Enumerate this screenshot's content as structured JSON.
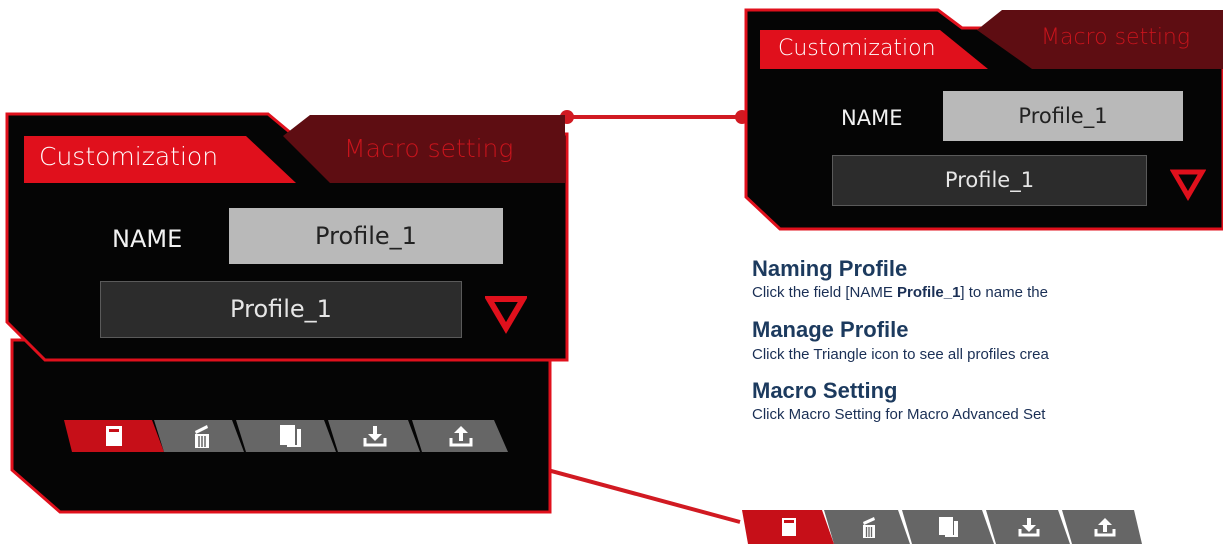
{
  "panel": {
    "tab_customization": "Customization",
    "tab_macro": "Macro setting",
    "name_label": "NAME",
    "name_value": "Profile_1",
    "profile_select_value": "Profile_1"
  },
  "zoom_panel": {
    "tab_customization": "Customization",
    "tab_macro": "Macro setting",
    "name_label": "NAME",
    "name_value": "Profile_1",
    "profile_select_value": "Profile_1"
  },
  "toolbar": {
    "buttons": [
      "new-profile",
      "delete-profile",
      "copy-profile",
      "import-profile",
      "export-profile"
    ]
  },
  "instructions": {
    "naming_title": "Naming Profile",
    "naming_text_pre": "Click the field [NAME ",
    "naming_text_bold": "Profile_1",
    "naming_text_post": "] to name the",
    "manage_title": "Manage Profile",
    "manage_text": "Click the Triangle icon  to see all profiles crea",
    "macro_title": "Macro Setting",
    "macro_text": "Click Macro Setting  for Macro Advanced Set"
  },
  "colors": {
    "accent_red": "#e0101c",
    "dark_red_tab": "#6a1015",
    "panel_bg": "#050505",
    "button_grey": "#6e6e6e"
  }
}
